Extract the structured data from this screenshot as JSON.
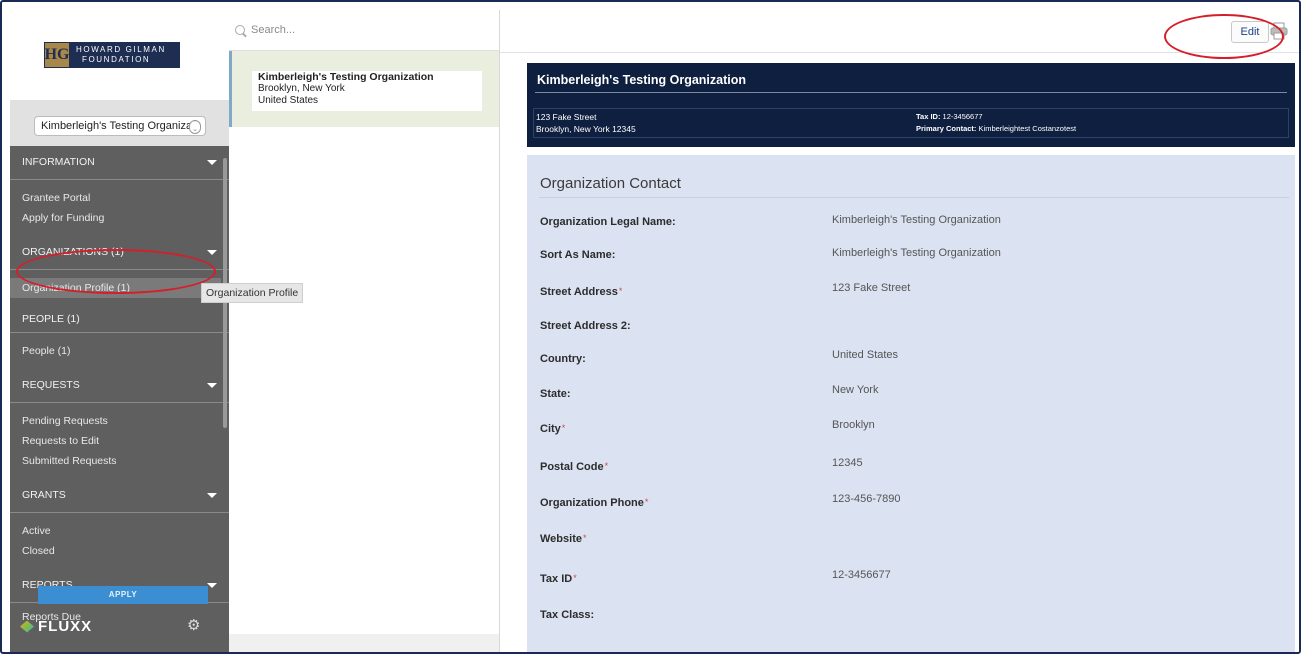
{
  "logo": {
    "mark": "HG",
    "line1": "HOWARD GILMAN",
    "line2": "FOUNDATION"
  },
  "org_select": {
    "value": "Kimberleigh's Testing Organiza"
  },
  "nav": {
    "information": "INFORMATION",
    "grantee_portal": "Grantee Portal",
    "apply_for_funding": "Apply for Funding",
    "organizations": "ORGANIZATIONS (1)",
    "organization_profile": "Organization Profile  (1)",
    "people": "PEOPLE (1)",
    "people_item": "People  (1)",
    "requests": "REQUESTS",
    "pending_requests": "Pending Requests",
    "requests_to_edit": "Requests to Edit",
    "submitted_requests": "Submitted Requests",
    "grants": "GRANTS",
    "active": "Active",
    "closed": "Closed",
    "reports": "REPORTS",
    "reports_due": "Reports Due"
  },
  "apply_label": "APPLY",
  "brand": "FLUXX",
  "tooltip": "Organization Profile",
  "search": {
    "placeholder": "Search..."
  },
  "list_item": {
    "name": "Kimberleigh's Testing Organization",
    "city": "Brooklyn, New York",
    "country": "United States"
  },
  "toolbar": {
    "edit_label": "Edit"
  },
  "header": {
    "title": "Kimberleigh's Testing Organization",
    "street": "123 Fake Street",
    "city_line": "Brooklyn, New York 12345",
    "tax_label": "Tax ID:",
    "tax_value": " 12-3456677",
    "contact_label": "Primary Contact:",
    "contact_value": " Kimberleightest Costanzotest"
  },
  "section_title": "Organization Contact",
  "fields": [
    {
      "label": "Organization Legal Name:",
      "value": "Kimberleigh's Testing Organization",
      "required": false
    },
    {
      "label": "Sort As Name:",
      "value": "Kimberleigh's Testing Organization",
      "required": false
    },
    {
      "label": "Street Address",
      "value": "123 Fake Street",
      "required": true
    },
    {
      "label": "Street Address 2:",
      "value": "",
      "required": false
    },
    {
      "label": "Country:",
      "value": "United States",
      "required": false
    },
    {
      "label": "State:",
      "value": "New York",
      "required": false
    },
    {
      "label": "City",
      "value": "Brooklyn",
      "required": true
    },
    {
      "label": "Postal Code",
      "value": "12345",
      "required": true
    },
    {
      "label": "Organization Phone",
      "value": "123-456-7890",
      "required": true
    },
    {
      "label": "Website",
      "value": "",
      "required": true
    },
    {
      "label": "Tax ID",
      "value": "12-3456677",
      "required": true
    },
    {
      "label": "Tax Class:",
      "value": "",
      "required": false
    }
  ],
  "required_mark": "*",
  "colors": {
    "header_navy": "#0e1f3f",
    "panel_blue": "#dbe2f1",
    "annotation_red": "#d51e2b",
    "sidebar_gray": "#5f5f5f"
  }
}
